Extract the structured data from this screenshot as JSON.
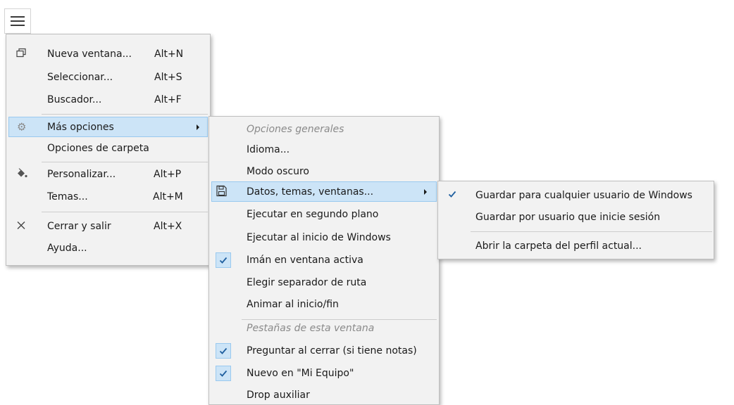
{
  "hamburger": {
    "icon": "menu-icon"
  },
  "main_menu": {
    "items": [
      {
        "label": "Nueva ventana...",
        "shortcut": "Alt+N",
        "icon": "new-window-icon"
      },
      {
        "label": "Seleccionar...",
        "shortcut": "Alt+S"
      },
      {
        "label": "Buscador...",
        "shortcut": "Alt+F"
      },
      {
        "label": "Más opciones",
        "icon": "settings-icon",
        "highlighted": true,
        "has_submenu": true
      },
      {
        "label": "Opciones de carpeta"
      },
      {
        "label": "Personalizar...",
        "shortcut": "Alt+P",
        "icon": "paint-bucket-icon"
      },
      {
        "label": "Temas...",
        "shortcut": "Alt+M"
      },
      {
        "label": "Cerrar y salir",
        "shortcut": "Alt+X",
        "icon": "close-icon"
      },
      {
        "label": "Ayuda..."
      }
    ]
  },
  "submenu": {
    "header_general": "Opciones generales",
    "items": [
      {
        "label": "Idioma..."
      },
      {
        "label": "Modo oscuro"
      },
      {
        "label": "Datos, temas, ventanas...",
        "icon": "save-icon",
        "highlighted": true,
        "has_submenu": true
      },
      {
        "label": "Ejecutar en segundo plano"
      },
      {
        "label": "Ejecutar al inicio de Windows"
      },
      {
        "label": "Imán en ventana activa",
        "checked": true
      },
      {
        "label": "Elegir separador de ruta"
      },
      {
        "label": "Animar al inicio/fin"
      }
    ],
    "header_tabs": "Pestañas de esta ventana",
    "tab_items": [
      {
        "label": "Preguntar al cerrar (si tiene notas)",
        "checked": true
      },
      {
        "label": "Nuevo en \"Mi Equipo\"",
        "checked": true
      },
      {
        "label": "Drop auxiliar"
      }
    ]
  },
  "submenu2": {
    "items": [
      {
        "label": "Guardar para cualquier usuario de Windows",
        "checked": true
      },
      {
        "label": "Guardar por usuario que inicie sesión"
      },
      {
        "label": "Abrir la carpeta del perfil actual..."
      }
    ]
  },
  "colors": {
    "menu_bg": "#f2f2f2",
    "highlight_bg": "#cce4f7",
    "highlight_border": "#99c9ef",
    "header_text": "#8a8a8a"
  }
}
